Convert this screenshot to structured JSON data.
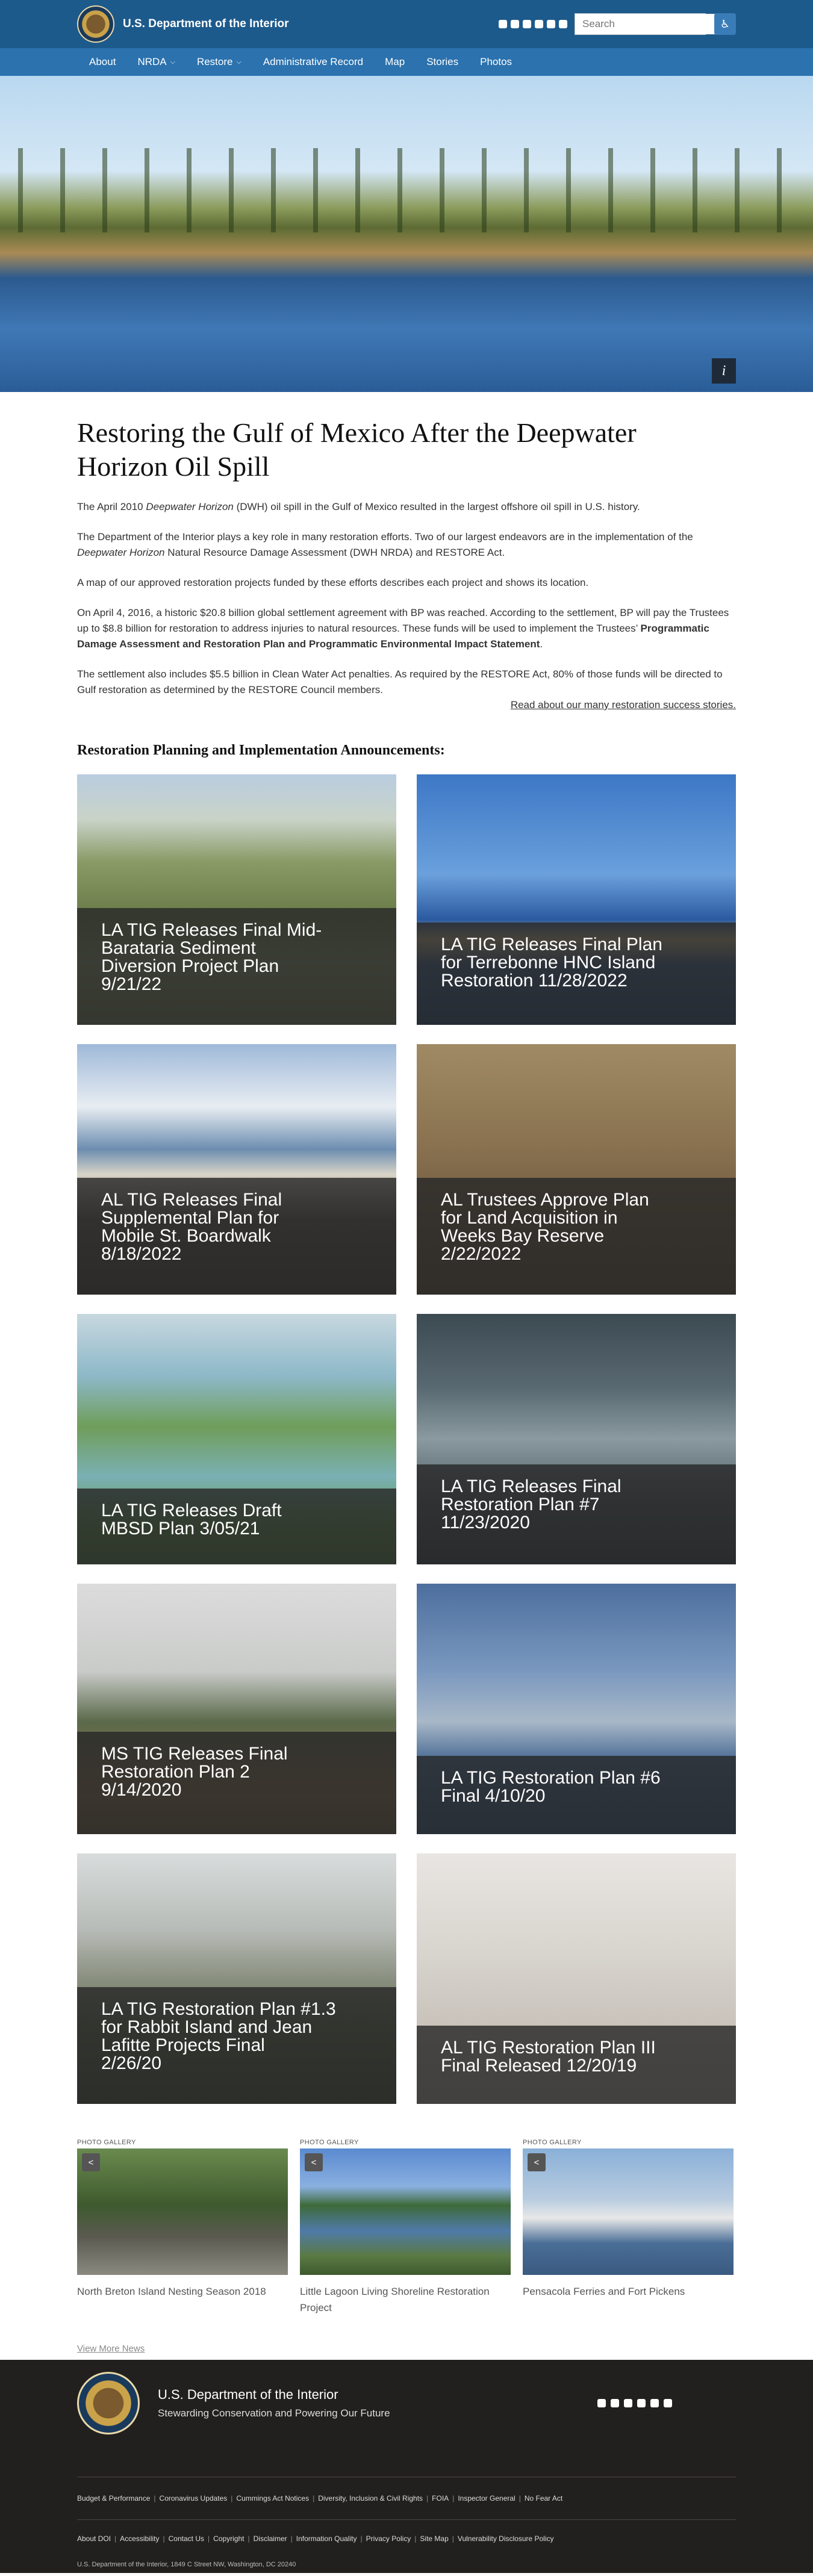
{
  "header": {
    "brand": "U.S. Department of the Interior",
    "social_icons": [
      "instagram-icon",
      "facebook-icon",
      "twitter-icon",
      "tumblr-icon",
      "linkedin-icon",
      "youtube-icon"
    ],
    "search_placeholder": "Search",
    "colors": {
      "topbar": "#1d5a8c",
      "navbar": "#2b72ae"
    }
  },
  "nav": {
    "items": [
      {
        "label": "About"
      },
      {
        "label": "NRDA",
        "has_dropdown": true
      },
      {
        "label": "Restore",
        "has_dropdown": true
      },
      {
        "label": "Administrative Record"
      },
      {
        "label": "Map"
      },
      {
        "label": "Stories"
      },
      {
        "label": "Photos"
      }
    ]
  },
  "hero": {
    "info_label": "i"
  },
  "page": {
    "title": "Restoring the Gulf of Mexico After the Deepwater Horizon Oil Spill",
    "p1_pre": "The April 2010 ",
    "p1_em": "Deepwater Horizon",
    "p1_post": " (DWH) oil spill in the Gulf of Mexico resulted in the largest offshore oil spill in U.S. history.",
    "p2_pre": "The Department of the Interior plays a key role in many restoration efforts. Two of our largest endeavors are in the implementation of the ",
    "p2_link1_em": "Deepwater Horizon",
    "p2_link1_rest": " Natural Resource Damage Assessment",
    "p2_mid": " (DWH NRDA) and ",
    "p2_link2": "RESTORE Act",
    "p2_end": ".",
    "p3_pre": "A ",
    "p3_link": "map of our approved restoration projects",
    "p3_post": " funded by these efforts describes each project and shows its location.",
    "p4_pre": "On April 4, 2016, a historic $20.8 billion global settlement agreement with BP was reached. According to the settlement, BP will pay the Trustees up to $8.8 billion for restoration to address injuries to natural resources. These funds will be used to implement the Trustees’ ",
    "p4_link": "Programmatic Damage Assessment and Restoration Plan and Programmatic Environmental Impact Statement",
    "p4_end": ".",
    "p5": "The settlement also includes $5.5 billion in Clean Water Act penalties. As required by the RESTORE Act, 80% of those funds will be directed to Gulf restoration as determined by the RESTORE Council members.",
    "success_link": "Read about our many restoration success stories."
  },
  "announcements": {
    "heading": "Restoration Planning and Implementation Announcements:",
    "cards": [
      {
        "lines": [
          "LA TIG Releases Final Mid-",
          "Barataria Sediment",
          "Diversion Project Plan",
          "9/21/22"
        ],
        "image": "aerial-diversion-photo"
      },
      {
        "lines": [
          "LA TIG Releases Final Plan",
          "for Terrebonne HNC Island",
          "Restoration 11/28/2022"
        ],
        "image": "island-aerial-photo"
      },
      {
        "lines": [
          "AL TIG Releases Final",
          "Supplemental Plan for",
          "Mobile St. Boardwalk",
          "8/18/2022"
        ],
        "image": "boardwalk-photo"
      },
      {
        "lines": [
          "AL Trustees Approve Plan",
          "for Land Acquisition in",
          "Weeks Bay Reserve",
          "2/22/2022"
        ],
        "image": "tern-bird-photo"
      },
      {
        "lines": [
          "LA TIG Releases Draft",
          "MBSD Plan 3/05/21"
        ],
        "image": "marsh-aerial-photo"
      },
      {
        "lines": [
          "LA TIG Releases Final",
          "Restoration Plan #7",
          "11/23/2020"
        ],
        "image": "spoonbill-photo"
      },
      {
        "lines": [
          "MS TIG Releases Final",
          "Restoration Plan 2",
          "9/14/2020"
        ],
        "image": "pine-savanna-photo"
      },
      {
        "lines": [
          "LA TIG Restoration Plan #6",
          "Final 4/10/20"
        ],
        "image": "bay-shoreline-photo"
      },
      {
        "lines": [
          "LA TIG Restoration Plan #1.3",
          "for Rabbit Island and Jean",
          "Lafitte Projects Final",
          "2/26/20"
        ],
        "image": "pelican-colony-photo"
      },
      {
        "lines": [
          "AL TIG Restoration Plan III",
          "Final Released 12/20/19"
        ],
        "image": "snowy-plover-photo"
      }
    ]
  },
  "gallery": {
    "kicker": "PHOTO GALLERY",
    "items": [
      {
        "caption": "North Breton Island Nesting Season 2018"
      },
      {
        "caption": "Little Lagoon Living Shoreline Restoration Project"
      },
      {
        "caption": "Pensacola Ferries and Fort Pickens"
      }
    ]
  },
  "view_more": "View More News",
  "footer": {
    "name": "U.S. Department of the Interior",
    "tagline": "Stewarding Conservation and Powering Our Future",
    "links_row1": [
      "Budget & Performance",
      "Coronavirus Updates",
      "Cummings Act Notices",
      "Diversity, Inclusion & Civil Rights",
      "FOIA",
      "Inspector General",
      "No Fear Act"
    ],
    "links_row2": [
      "About DOI",
      "Accessibility",
      "Contact Us",
      "Copyright",
      "Disclaimer",
      "Information Quality",
      "Privacy Policy",
      "Site Map",
      "Vulnerability Disclosure Policy"
    ],
    "address": "U.S. Department of the Interior, 1849 C Street NW, Washington, DC 20240"
  }
}
